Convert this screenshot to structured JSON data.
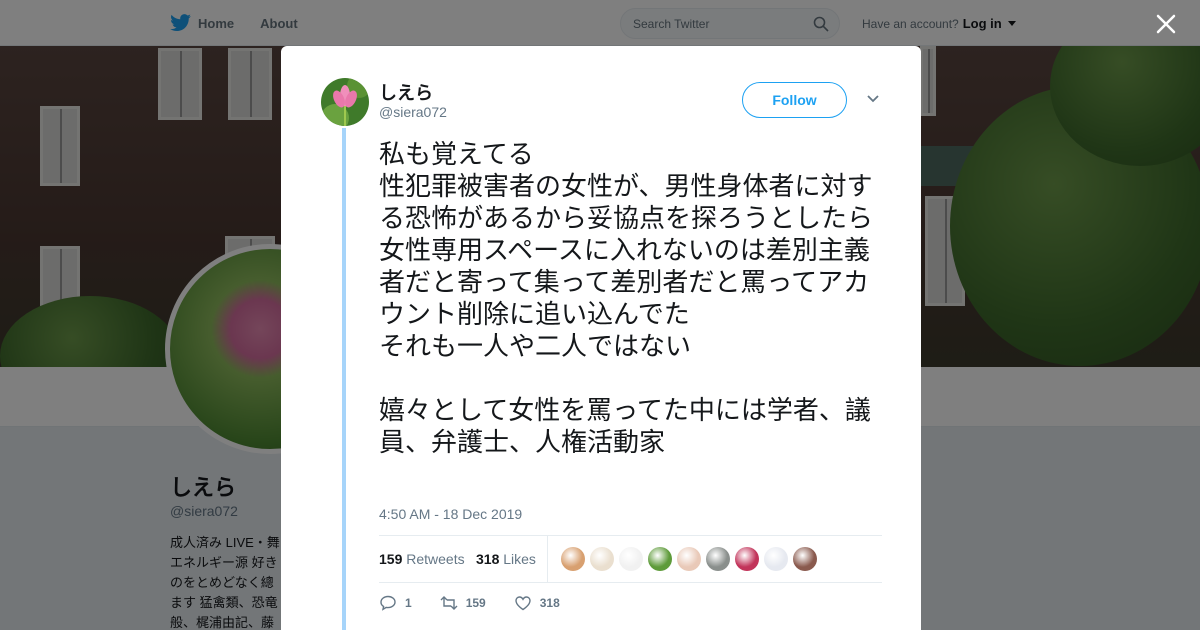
{
  "nav": {
    "home": "Home",
    "about": "About"
  },
  "search": {
    "placeholder": "Search Twitter"
  },
  "account": {
    "prompt": "Have an account?",
    "login": "Log in"
  },
  "profile": {
    "name": "しえら",
    "handle": "@siera072",
    "bio": "成人済み LIVE・舞\nエネルギー源 好き\nのをとめどなく總\nます 猛禽類、恐竜\n般、梶浦由記、藤"
  },
  "tweet": {
    "name": "しえら",
    "handle": "@siera072",
    "follow_label": "Follow",
    "text": "私も覚えてる\n性犯罪被害者の女性が、男性身体者に対する恐怖があるから妥協点を探ろうとしたら女性専用スペースに入れないのは差別主義者だと寄って集って差別者だと罵ってアカウント削除に追い込んでた\nそれも一人や二人ではない\n\n嬉々として女性を罵ってた中には学者、議員、弁護士、人権活動家",
    "timestamp": "4:50 AM - 18 Dec 2019",
    "retweets_count": "159",
    "retweets_label": "Retweets",
    "likes_count": "318",
    "likes_label": "Likes",
    "reply_count": "1",
    "retweet_action_count": "159",
    "like_action_count": "318"
  },
  "colors": {
    "brand": "#1da1f2",
    "thread_line": "#a6d4fa",
    "muted_text": "#657786"
  },
  "likers": [
    {
      "name": "liker-1",
      "color": "#d8a070"
    },
    {
      "name": "liker-2",
      "color": "#eadfcf"
    },
    {
      "name": "liker-3",
      "color": "#f1f1f1"
    },
    {
      "name": "liker-4",
      "color": "#5e9b3a"
    },
    {
      "name": "liker-5",
      "color": "#e9c9b8"
    },
    {
      "name": "liker-6",
      "color": "#8a8f8c"
    },
    {
      "name": "liker-7",
      "color": "#c2345a"
    },
    {
      "name": "liker-8",
      "color": "#e6e9f0"
    },
    {
      "name": "liker-9",
      "color": "#8a5a4e"
    }
  ]
}
